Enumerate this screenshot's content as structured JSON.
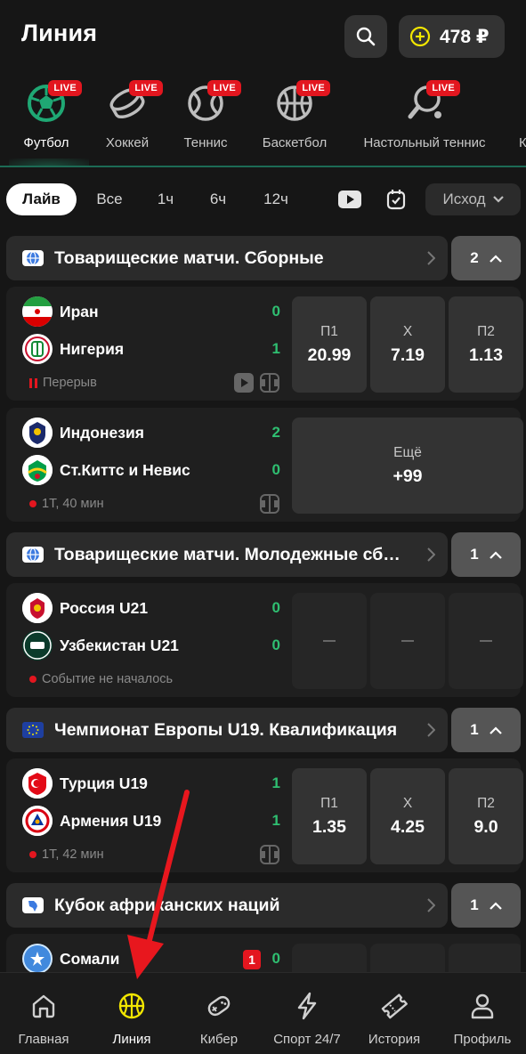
{
  "header": {
    "title": "Линия",
    "balance": "478 ₽"
  },
  "colors": {
    "accent_green": "#2fbf71",
    "live_red": "#e3161f",
    "coin_yellow": "#f2e600"
  },
  "sports": [
    {
      "label": "Футбол",
      "live": "LIVE",
      "icon": "soccer-ball-icon"
    },
    {
      "label": "Хоккей",
      "live": "LIVE",
      "icon": "hockey-puck-icon"
    },
    {
      "label": "Теннис",
      "live": "LIVE",
      "icon": "tennis-ball-icon"
    },
    {
      "label": "Баскетбол",
      "live": "LIVE",
      "icon": "basketball-icon"
    },
    {
      "label": "Настольный теннис",
      "live": "LIVE",
      "icon": "table-tennis-icon"
    },
    {
      "label": "К",
      "icon": ""
    }
  ],
  "filters": {
    "live": "Лайв",
    "all": "Все",
    "h1": "1ч",
    "h6": "6ч",
    "h12": "12ч",
    "outcome": "Исход"
  },
  "leagues": [
    {
      "name": "Товарищеские матчи. Сборные",
      "count": "2",
      "flag": "globe-icon"
    },
    {
      "name": "Товарищеские матчи. Молодежные сб…",
      "count": "1",
      "flag": "globe-icon"
    },
    {
      "name": "Чемпионат Европы U19. Квалификация",
      "count": "1",
      "flag": "eu-flag-icon"
    },
    {
      "name": "Кубок африканских наций",
      "count": "1",
      "flag": "africa-icon"
    }
  ],
  "matches": [
    {
      "home": "Иран",
      "home_score": "0",
      "away": "Нигерия",
      "away_score": "1",
      "status": "Перерыв",
      "odds": [
        {
          "label": "П1",
          "value": "20.99"
        },
        {
          "label": "Х",
          "value": "7.19"
        },
        {
          "label": "П2",
          "value": "1.13"
        }
      ]
    },
    {
      "home": "Индонезия",
      "home_score": "2",
      "away": "Ст.Киттс и Невис",
      "away_score": "0",
      "status": "1Т, 40 мин",
      "more_label": "Ещё",
      "more_value": "+99"
    },
    {
      "home": "Россия U21",
      "home_score": "0",
      "away": "Узбекистан U21",
      "away_score": "0",
      "status": "Событие не началось"
    },
    {
      "home": "Турция U19",
      "home_score": "1",
      "away": "Армения U19",
      "away_score": "1",
      "status": "1Т, 42 мин",
      "odds": [
        {
          "label": "П1",
          "value": "1.35"
        },
        {
          "label": "Х",
          "value": "4.25"
        },
        {
          "label": "П2",
          "value": "9.0"
        }
      ]
    },
    {
      "home": "Сомали",
      "home_score": "0",
      "red_cards": "1"
    }
  ],
  "nav": [
    {
      "label": "Главная",
      "icon": "home-icon"
    },
    {
      "label": "Линия",
      "icon": "basketball-icon"
    },
    {
      "label": "Кибер",
      "icon": "gamepad-icon"
    },
    {
      "label": "Спорт 24/7",
      "icon": "lightning-icon"
    },
    {
      "label": "История",
      "icon": "ticket-icon"
    },
    {
      "label": "Профиль",
      "icon": "user-icon"
    }
  ]
}
